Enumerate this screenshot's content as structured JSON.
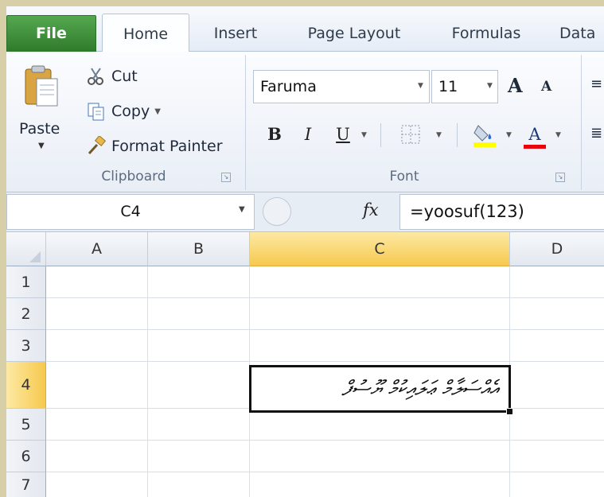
{
  "tabs": {
    "file": "File",
    "home": "Home",
    "insert": "Insert",
    "page_layout": "Page Layout",
    "formulas": "Formulas",
    "data": "Data"
  },
  "clipboard": {
    "paste": "Paste",
    "cut": "Cut",
    "copy": "Copy",
    "format_painter": "Format Painter",
    "group_label": "Clipboard"
  },
  "font": {
    "name": "Faruma",
    "size": "11",
    "bold": "B",
    "italic": "I",
    "underline": "U",
    "grow": "A",
    "shrink": "A",
    "font_color": "A",
    "group_label": "Font",
    "fill_color": "#ffff00",
    "text_color": "#e8000b"
  },
  "formula_bar": {
    "name_box": "C4",
    "fx": "fx",
    "formula": "=yoosuf(123)"
  },
  "grid": {
    "columns": [
      "A",
      "B",
      "C",
      "D"
    ],
    "rows": [
      "1",
      "2",
      "3",
      "4",
      "5",
      "6",
      "7"
    ],
    "active_cell": {
      "ref": "C4",
      "value": "އެއްސަލާމް ޢަލައިކުމް ޔޫސުފް"
    }
  }
}
